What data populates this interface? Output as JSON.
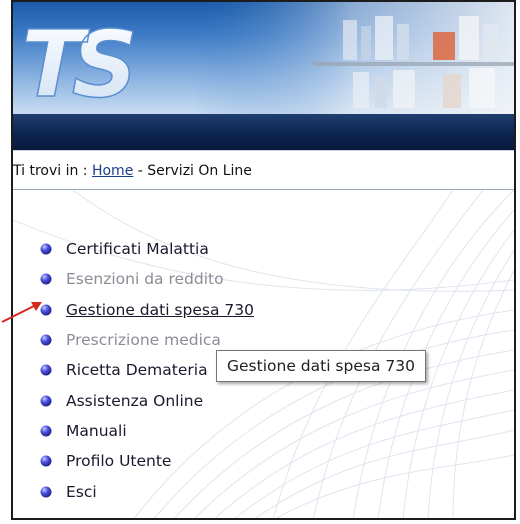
{
  "banner": {
    "logo_text": "TS"
  },
  "breadcrumb": {
    "prefix": "Ti trovi in : ",
    "home_link": "Home",
    "separator": " - ",
    "current": "Servizi On Line"
  },
  "menu": {
    "items": [
      {
        "label": "Certificati Malattia",
        "state": "enabled"
      },
      {
        "label": "Esenzioni da reddito",
        "state": "disabled"
      },
      {
        "label": "Gestione dati spesa 730",
        "state": "hovered"
      },
      {
        "label": "Prescrizione medica",
        "state": "disabled"
      },
      {
        "label": "Ricetta Demateria",
        "state": "enabled"
      },
      {
        "label": "Assistenza Online",
        "state": "enabled"
      },
      {
        "label": "Manuali",
        "state": "enabled"
      },
      {
        "label": "Profilo Utente",
        "state": "enabled"
      },
      {
        "label": "Esci",
        "state": "enabled"
      }
    ]
  },
  "tooltip": {
    "text": "Gestione dati spesa 730"
  },
  "colors": {
    "navbar": "#0c2450",
    "link": "#1b3f8a",
    "bullet": "#3b3fc8",
    "disabled_text": "#8c8c96",
    "annotation_arrow": "#d42a1e"
  },
  "icons": {
    "bullet": "bullet-orb-icon",
    "annotation": "red-arrow-icon"
  }
}
